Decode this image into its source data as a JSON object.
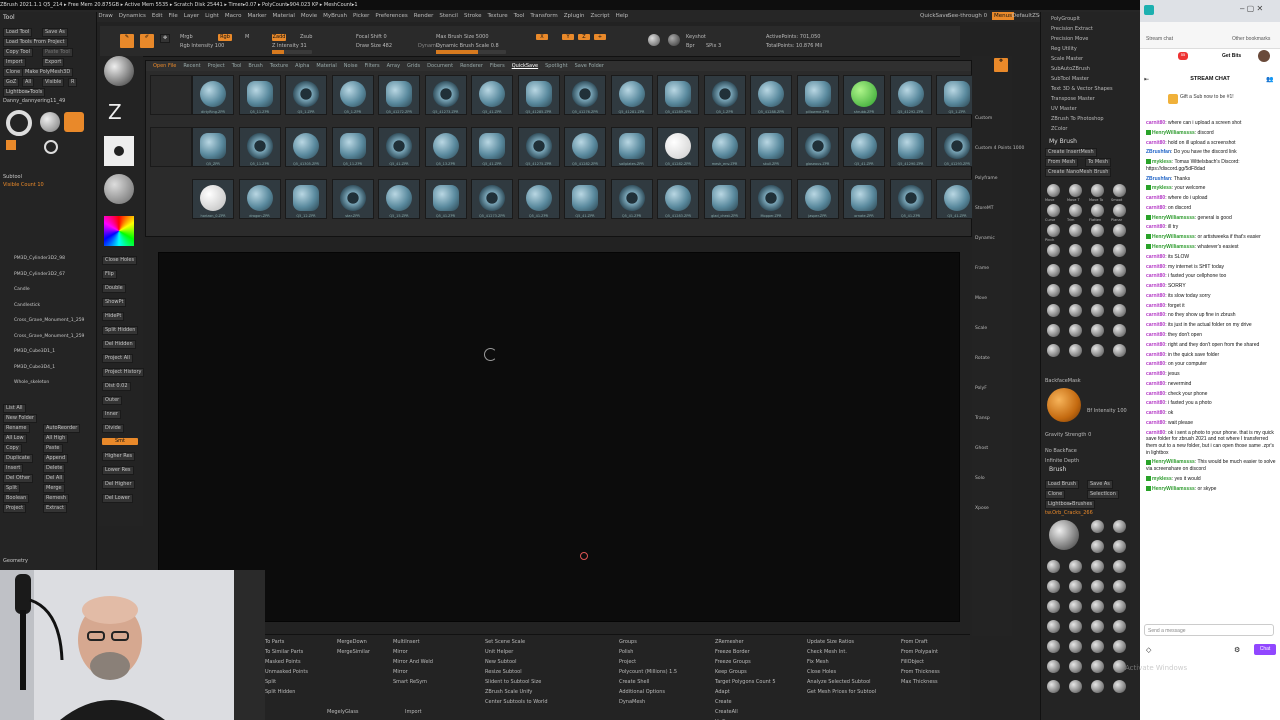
{
  "title_bar": "ZBrush 2021.1.1  Q5_214  ▸ Free Mem 20.875GB ▸ Active Mem 5535 ▸ Scratch Disk 25441 ▸ Timer▸0.07 ▸ PolyCount▸904.023 KP ▸ MeshCount▸1",
  "menu": [
    "Alpha",
    "Brush",
    "Color",
    "Document",
    "Draw",
    "Dynamics",
    "Edit",
    "File",
    "Layer",
    "Light",
    "Macro",
    "Marker",
    "Material",
    "Movie",
    "MyBrush",
    "Picker",
    "Preferences",
    "Render",
    "Stencil",
    "Stroke",
    "Texture",
    "Tool",
    "Transform",
    "Zplugin",
    "Zscript",
    "Help"
  ],
  "menu_right": [
    "QuickSave",
    "See-through 0",
    "Menus",
    "DefaultZScript"
  ],
  "top_bar": {
    "mrgb": "Mrgb",
    "rgb": "Rgb",
    "m": "M",
    "zadd": "Zadd",
    "zsub": "Zsub",
    "focal_shift": "Focal Shift 0",
    "draw_size": "Draw Size 482",
    "dynamic": "Dynamic",
    "rgb_intensity": "Rgb Intensity 100",
    "z_intensity": "Z Intensity 31",
    "max_brush_size": "Max Brush Size 5000",
    "dynamic_brush_scale": "Dynamic Brush Scale 0.8",
    "active_points": "ActivePoints: 701,050",
    "total_points": "TotalPoints: 10.876 Mil",
    "keyshot": "Keyshot",
    "bpr": "Bpr",
    "spix": "SPix 3"
  },
  "tool_panel": {
    "title": "Tool",
    "buttons": [
      "Load Tool",
      "Save As",
      "Load Tools From Project",
      "Copy Tool",
      "Paste Tool",
      "Import",
      "Export",
      "Clone",
      "Make PolyMesh3D",
      "GoZ",
      "All",
      "Visible",
      "R",
      "Lightbox▸Tools"
    ],
    "current_tool": "Danny_dannyering11_49",
    "subtool_label": "Subtool",
    "visible_count": "Visible Count 10",
    "subtools": [
      "PM3D_Cylinder3D2_98",
      "PM3D_Cylinder3D2_67",
      "Candle",
      "Candlestick",
      "Cross_Grave_Monument_1_259",
      "Cross_Grave_Monument_1_259",
      "PM3D_Cube3D1_1",
      "PM3D_Cube3D4_1",
      "Whole_skeleton"
    ],
    "list_all": "List All",
    "new_folder": "New Folder",
    "ops": [
      "Rename",
      "AutoReorder",
      "All Low",
      "All High",
      "Copy",
      "Paste",
      "Duplicate",
      "Append",
      "Insert",
      "Delete",
      "Del Other",
      "Del All",
      "Split",
      "Merge",
      "Boolean",
      "Remesh",
      "Project",
      "Extract"
    ],
    "geometry": "Geometry"
  },
  "left_strip": [
    "Close Holes",
    "Flip",
    "Double",
    "ShowPt",
    "HidePt",
    "Split Hidden",
    "Del Hidden",
    "Project All",
    "Project History",
    "Dist 0.02",
    "Outer",
    "Inner",
    "Divide",
    "Smt",
    "Higher Res",
    "Lower Res",
    "Del Higher",
    "Del Lower"
  ],
  "lightbox": {
    "tabs": [
      "Open File",
      "Recent",
      "Project",
      "Tool",
      "Brush",
      "Texture",
      "Alpha",
      "Material",
      "Noise",
      "Filters",
      "Array",
      "Grids",
      "Document",
      "Renderer",
      "Fibers",
      "QuickSave",
      "Spotlight",
      "Save Folder"
    ],
    "thumbs_row1": [
      "dirtyRing.ZPR",
      "Q5_11.ZPR",
      "Q5_1.ZPR",
      "Q5_1.ZPR",
      "Q5_41272.ZPR",
      "Q5_41273.ZPR",
      "Q5_41.ZPR",
      "Q5_41285.ZPR",
      "Q5_41276.ZPR",
      "Q5_41281.ZPR",
      "Q5_41289.ZPR",
      "Q5_1.ZPR",
      "Q5_41288.ZPR",
      "pillowme.ZPR",
      "shrubb.ZPR",
      "Q5_41292.ZPR",
      "Q5_1.ZPR"
    ],
    "thumbs_row2": [
      "Q5_ZPR",
      "Q5_11.ZPR",
      "Q5_41305.ZPR",
      "Q5_11.ZPR",
      "Q5_41.ZPR",
      "Q5_13.ZPR",
      "Q5_41.ZPR",
      "Q5_41275.ZPR",
      "Q5_41282.ZPR",
      "sailplates.ZPR",
      "Q5_41282.ZPR",
      "mesh_env.ZPR",
      "skull.ZPR",
      "glaseous.ZPR",
      "Q5_41.ZPR",
      "Q5_41290.ZPR",
      "Q5_41293.ZPR"
    ],
    "thumbs_row3": [
      "horizon_0.ZPR",
      "dragon.ZPR",
      "Q5_12.ZPR",
      "star.ZPR",
      "Q5_15.ZPR",
      "Q5_41.ZPR",
      "Q5_41273.ZPR",
      "Q5_41.ZPR",
      "Q5_41.ZPR",
      "Q5_41.ZPR",
      "Q5_41283.ZPR",
      "glad_chest.ZPR",
      "Mopper.ZPR",
      "jasper.ZPR",
      "ornate.ZPR",
      "Q5_41.ZPR",
      "Q5_41.ZPR"
    ]
  },
  "right_strip": [
    "Custom",
    "Custom 4 Points 1000",
    "Polyframe",
    "StoreMT",
    "Dynamic",
    "Frame",
    "Move",
    "Scale",
    "Rotate",
    "PolyF",
    "Transp",
    "Ghost",
    "Solo",
    "Xpose"
  ],
  "right_panel": {
    "items": [
      "PolyGroupIt",
      "Precision Extract",
      "Precision Move",
      "Reg Utility",
      "Scale Master",
      "SubAutoZBrush",
      "SubTool Master",
      "Text 3D & Vector Shapes",
      "Transpose Master",
      "UV Master",
      "ZBrush To Photoshop",
      "ZColor"
    ],
    "mybrush": "My Brush",
    "mybrush_buttons": [
      "Create InsertMesh",
      "From Mesh",
      "To Mesh",
      "Create NanoMesh Brush"
    ],
    "brushes_row": [
      "Move",
      "Move T",
      "Move To",
      "Smoot",
      "Curve",
      "Trim",
      "Flatten",
      "Planar",
      "Pinch"
    ],
    "backface": "BackfaceMask",
    "bf_intensity": "Bf Intensity 100",
    "gravity": "Gravity Strength 0",
    "no_backface": "No BackFace",
    "infinite_depth": "Infinite Depth",
    "brush_title": "Brush",
    "brush_buttons": [
      "Load Brush",
      "Save As",
      "Clone",
      "SelectIcon",
      "Lightbox▸Brushes"
    ],
    "current_brush": "tw.Orb_Cracks_266"
  },
  "bottom_shelf": {
    "col1": [
      "To Parts",
      "To Similar Parts",
      "Masked Points",
      "Unmasked Points",
      "Split",
      "Split Hidden"
    ],
    "col2": [
      "MergeDown",
      "MergeSimilar"
    ],
    "col3": [
      "MultiInsert",
      "Mirror",
      "Mirror And Weld",
      "Mirror",
      "Smart ReSym"
    ],
    "col4": [
      "Set Scene Scale",
      "Unit Helper",
      "New Subtool",
      "Resize Subtool",
      "Slident to Subtool Size",
      "ZBrush Scale Unify",
      "Center Subtools to World"
    ],
    "col5": [
      "Groups",
      "Polish",
      "Project",
      "Polycount (Millions) 1.5",
      "Create Shell",
      "Additional Options",
      "DynaMesh"
    ],
    "col6": [
      "ZRemesher",
      "Freeze Border",
      "Freeze Groups",
      "Keep Groups",
      "Target Polygons Count 5",
      "Adapt",
      "Create",
      "CreateAll",
      "UnCrease",
      "UnCreaseAll"
    ],
    "col7": [
      "Update Size Ratios",
      "Check Mesh Int.",
      "Fix Mesh",
      "Close Holes",
      "Analyze Selected Subtool",
      "Get Mesh Prices for Subtool"
    ],
    "col8": [
      "From Draft",
      "From Polypaint",
      "FillObject",
      "From Thickness",
      "Max Thickness"
    ],
    "merge": "MegelyGlass",
    "import": "Import"
  },
  "chat": {
    "tab_title": "Stream chat",
    "bookmark": "Other bookmarks",
    "get_bits": "Get Bits",
    "header": "STREAM CHAT",
    "sub_banner": "Gift a Sub now to be #1!",
    "messages": [
      {
        "user": "carnit80",
        "cls": "u1",
        "text": "where can i upload a screen shot"
      },
      {
        "user": "HenryWilliamssss",
        "cls": "u2",
        "text": "discord"
      },
      {
        "user": "carnit80",
        "cls": "u1",
        "text": "hold on ill upload a screenshot"
      },
      {
        "user": "ZBrushfan",
        "cls": "u3",
        "text": "Do you have the discord link"
      },
      {
        "user": "mykless",
        "cls": "u2",
        "text": "Tomas Wittelsbach's Discord: https://discord.gg/5dF8dad"
      },
      {
        "user": "ZBrushfan",
        "cls": "u3",
        "text": "Thanks"
      },
      {
        "user": "mykless",
        "cls": "u2",
        "text": "your welcome"
      },
      {
        "user": "carnit80",
        "cls": "u1",
        "text": "where do i upload"
      },
      {
        "user": "carnit80",
        "cls": "u1",
        "text": "on discord"
      },
      {
        "user": "HenryWilliamssss",
        "cls": "u2",
        "text": "general is good"
      },
      {
        "user": "carnit80",
        "cls": "u1",
        "text": "ill try"
      },
      {
        "user": "HenryWilliamssss",
        "cls": "u2",
        "text": "or artistweeka if that's easier"
      },
      {
        "user": "HenryWilliamssss",
        "cls": "u2",
        "text": "whatever's easiest"
      },
      {
        "user": "carnit80",
        "cls": "u1",
        "text": "its SLOW"
      },
      {
        "user": "carnit80",
        "cls": "u1",
        "text": "my internet is SHIT today"
      },
      {
        "user": "carnit80",
        "cls": "u1",
        "text": "i faxted your cellphone too"
      },
      {
        "user": "carnit80",
        "cls": "u1",
        "text": "SORRY"
      },
      {
        "user": "carnit80",
        "cls": "u1",
        "text": "its slow today sorry"
      },
      {
        "user": "carnit80",
        "cls": "u1",
        "text": "forget it"
      },
      {
        "user": "carnit80",
        "cls": "u1",
        "text": "no they show up fine in zbrush"
      },
      {
        "user": "carnit80",
        "cls": "u1",
        "text": "its just in the actual folder on my drive"
      },
      {
        "user": "carnit80",
        "cls": "u1",
        "text": "they don't open"
      },
      {
        "user": "carnit80",
        "cls": "u1",
        "text": "right and they don't open from the shared"
      },
      {
        "user": "carnit80",
        "cls": "u1",
        "text": "in the quick save folder"
      },
      {
        "user": "carnit80",
        "cls": "u1",
        "text": "on your computer"
      },
      {
        "user": "carnit80",
        "cls": "u1",
        "text": "jesus"
      },
      {
        "user": "carnit80",
        "cls": "u1",
        "text": "nevermind"
      },
      {
        "user": "carnit80",
        "cls": "u1",
        "text": "check your phone"
      },
      {
        "user": "carnit80",
        "cls": "u1",
        "text": "i faxted you a photo"
      },
      {
        "user": "carnit80",
        "cls": "u1",
        "text": "ok"
      },
      {
        "user": "carnit80",
        "cls": "u1",
        "text": "wait please"
      },
      {
        "user": "carnit80",
        "cls": "u1",
        "text": "ok i sent a photo to your phone. that is my quick save folder for zbrush 2021 and not where I transferred them out to a new folder, but i can open those same .zpr's in lightbox"
      },
      {
        "user": "HenryWilliamssss",
        "cls": "u2",
        "text": "This would be much easier to solve via screenshare on discord"
      },
      {
        "user": "mykless",
        "cls": "u2",
        "text": "yes it would"
      },
      {
        "user": "HenryWilliamssss",
        "cls": "u2",
        "text": "or skype"
      }
    ],
    "input_placeholder": "Send a message",
    "chat_button": "Chat"
  },
  "windows_watermark": "Activate Windows",
  "accent": "#e9892a"
}
